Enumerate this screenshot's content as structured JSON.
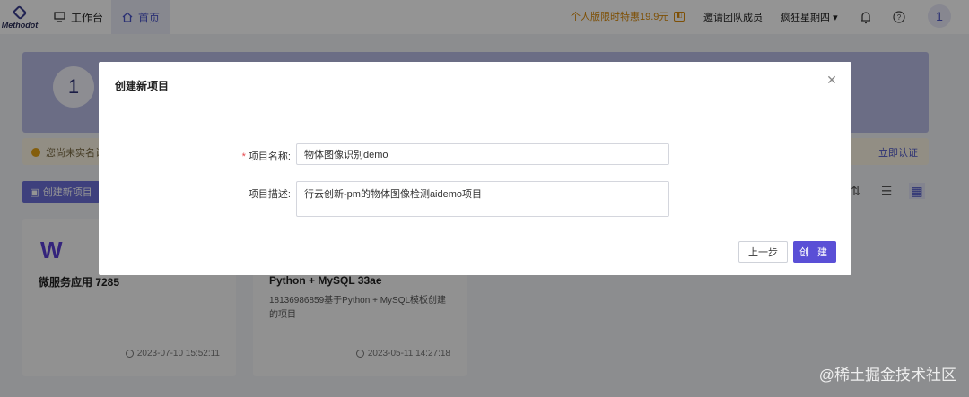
{
  "app": {
    "logo_text": "Methodot"
  },
  "nav": {
    "workbench": "工作台",
    "home": "首页"
  },
  "header": {
    "promo": "个人版限时特惠19.9元",
    "invite": "邀请团队成员",
    "username": "疯狂星期四",
    "avatar_text": "1"
  },
  "banner": {
    "circle_text": "1"
  },
  "notice": {
    "text": "您尚未实名认",
    "link": "立即认证"
  },
  "toolbar": {
    "new_project": "创建新项目"
  },
  "projects": [
    {
      "badge": "W",
      "title": "微服务应用 7285",
      "description": "",
      "time": "2023-07-10 15:52:11"
    },
    {
      "badge": "",
      "title": "Python + MySQL 33ae",
      "description": "18136986859基于Python + MySQL模板创建的项目",
      "time": "2023-05-11 14:27:18"
    }
  ],
  "modal": {
    "title": "创建新项目",
    "name_label": "项目名称:",
    "name_value": "物体图像识别demo",
    "desc_label": "项目描述:",
    "desc_value": "行云创新-pm的物体图像检测aidemo项目",
    "prev_button": "上一步",
    "create_button": "创 建"
  },
  "watermark": "@稀土掘金技术社区",
  "colors": {
    "accent": "#5a4fd6",
    "promo": "#d98a0b",
    "required": "#e5484d"
  }
}
